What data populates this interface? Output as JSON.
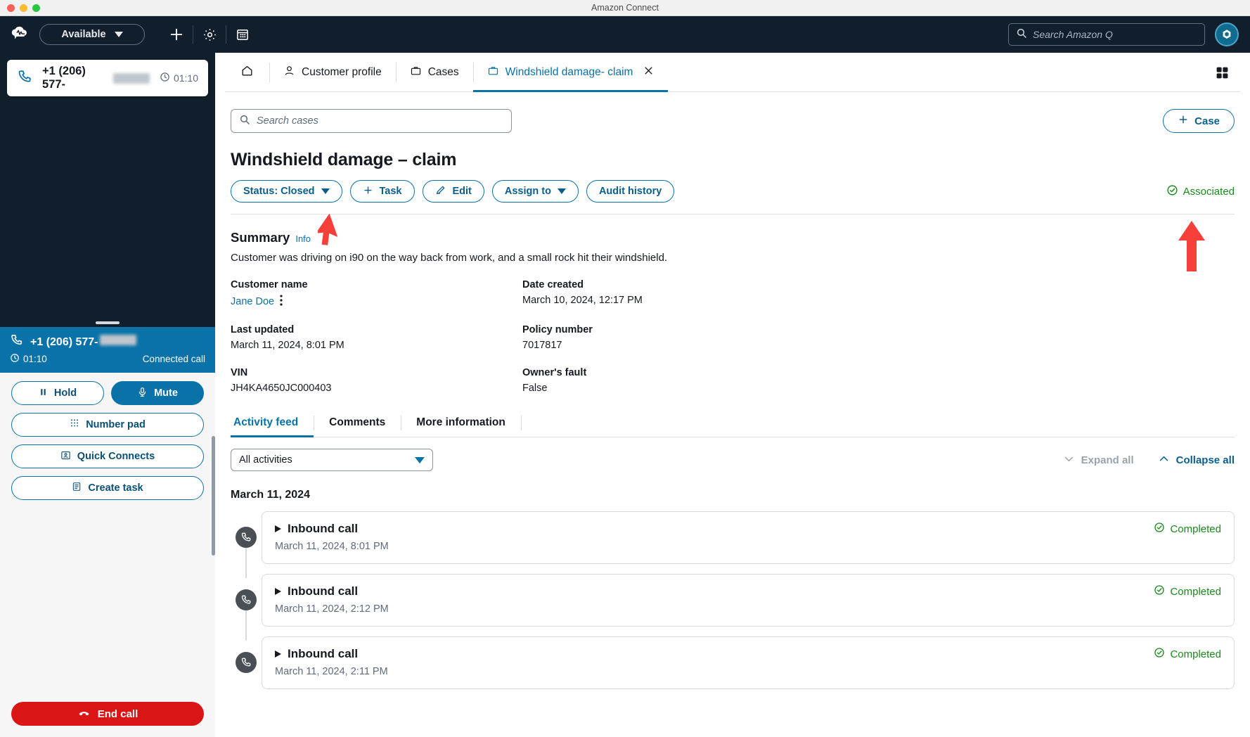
{
  "window": {
    "title": "Amazon Connect"
  },
  "topnav": {
    "logo_icon": "amazon-connect-cloud-logo",
    "status": {
      "label": "Available",
      "caret_icon": "chevron-down-icon"
    },
    "icons": [
      {
        "name": "add-icon",
        "glyph": "+"
      },
      {
        "name": "gear-icon",
        "glyph": "gear"
      },
      {
        "name": "calendar-icon",
        "glyph": "calendar"
      }
    ],
    "search": {
      "placeholder": "Search Amazon Q",
      "value": "",
      "icon": "search-icon"
    },
    "amazon_q_avatar": "amazon-q-icon"
  },
  "ccp": {
    "contact_card": {
      "phone": "+1 (206) 577-",
      "timer": "01:10",
      "phone_icon": "phone-icon",
      "clock_icon": "clock-icon"
    },
    "call_banner": {
      "phone": "+1 (206) 577-",
      "timer": "01:10",
      "state": "Connected call"
    },
    "buttons": [
      {
        "name": "hold-button",
        "label": "Hold",
        "icon": "pause-icon",
        "filled": false
      },
      {
        "name": "mute-button",
        "label": "Mute",
        "icon": "microphone-icon",
        "filled": true
      },
      {
        "name": "number-pad-button",
        "label": "Number pad",
        "icon": "dialpad-icon",
        "filled": false
      },
      {
        "name": "quick-connects-button",
        "label": "Quick Connects",
        "icon": "contact-card-icon",
        "filled": false
      },
      {
        "name": "create-task-button",
        "label": "Create task",
        "icon": "task-icon",
        "filled": false
      }
    ],
    "end_call": {
      "label": "End call",
      "icon": "end-call-icon",
      "color": "#d91515"
    }
  },
  "tabs": [
    {
      "name": "tab-home",
      "label": "",
      "icon": "home-icon",
      "active": false,
      "closable": false
    },
    {
      "name": "tab-customer-profile",
      "label": "Customer profile",
      "icon": "user-icon",
      "active": false,
      "closable": false
    },
    {
      "name": "tab-cases",
      "label": "Cases",
      "icon": "briefcase-icon",
      "active": false,
      "closable": false
    },
    {
      "name": "tab-windshield-damage-claim",
      "label": "Windshield damage- claim",
      "icon": "briefcase-icon",
      "active": true,
      "closable": true,
      "close_icon": "close-icon"
    }
  ],
  "tabbar_right": {
    "grid_icon": "apps-grid-icon"
  },
  "case_search": {
    "placeholder": "Search cases",
    "value": "",
    "icon": "search-icon"
  },
  "add_case_button": {
    "label": "Case",
    "icon": "plus-icon"
  },
  "case": {
    "title": "Windshield damage – claim",
    "actions": [
      {
        "name": "status-button",
        "label": "Status: Closed",
        "caret": true
      },
      {
        "name": "task-button",
        "label": "Task",
        "icon": "plus-icon"
      },
      {
        "name": "edit-button",
        "label": "Edit",
        "icon": "pencil-icon"
      },
      {
        "name": "assign-to-button",
        "label": "Assign to",
        "caret": true
      },
      {
        "name": "audit-history-button",
        "label": "Audit history"
      }
    ],
    "associated": {
      "label": "Associated",
      "icon": "check-circle-icon",
      "color": "#1a8a1a"
    },
    "summary": {
      "title": "Summary",
      "info_link": "Info",
      "text": "Customer was driving on i90 on the way back from work, and a small rock hit their windshield."
    },
    "fields": [
      [
        {
          "name": "customer-name",
          "label": "Customer name",
          "value": "Jane Doe",
          "is_link": true,
          "has_kebab": true
        },
        {
          "name": "date-created",
          "label": "Date created",
          "value": "March 10, 2024, 12:17 PM",
          "is_link": false,
          "has_kebab": false
        }
      ],
      [
        {
          "name": "last-updated",
          "label": "Last updated",
          "value": "March 11, 2024, 8:01 PM",
          "is_link": false,
          "has_kebab": false
        },
        {
          "name": "policy-number",
          "label": "Policy number",
          "value": "7017817",
          "is_link": false,
          "has_kebab": false
        }
      ],
      [
        {
          "name": "vin",
          "label": "VIN",
          "value": "JH4KA4650JC000403",
          "is_link": false,
          "has_kebab": false
        },
        {
          "name": "owners-fault",
          "label": "Owner's fault",
          "value": "False",
          "is_link": false,
          "has_kebab": false
        }
      ]
    ]
  },
  "feed_tabs": [
    {
      "name": "tab-activity-feed",
      "label": "Activity feed",
      "active": true
    },
    {
      "name": "tab-comments",
      "label": "Comments",
      "active": false
    },
    {
      "name": "tab-more-information",
      "label": "More information",
      "active": false
    }
  ],
  "feed_filter": {
    "value": "All activities",
    "caret_icon": "chevron-down-icon"
  },
  "expand_all": {
    "label": "Expand all",
    "icon": "chevron-down-icon",
    "enabled": false
  },
  "collapse_all": {
    "label": "Collapse all",
    "icon": "chevron-up-icon",
    "enabled": true
  },
  "activity": {
    "date_header": "March 11, 2024",
    "items": [
      {
        "title": "Inbound call",
        "timestamp": "March 11, 2024, 8:01 PM",
        "status": "Completed",
        "icon": "phone-icon",
        "status_icon": "check-circle-icon"
      },
      {
        "title": "Inbound call",
        "timestamp": "March 11, 2024, 2:12 PM",
        "status": "Completed",
        "icon": "phone-icon",
        "status_icon": "check-circle-icon"
      },
      {
        "title": "Inbound call",
        "timestamp": "March 11, 2024, 2:11 PM",
        "status": "Completed",
        "icon": "phone-icon",
        "status_icon": "check-circle-icon"
      }
    ]
  },
  "annotations": [
    {
      "name": "arrow-pointing-to-status-button",
      "color": "#f7403a"
    },
    {
      "name": "arrow-pointing-to-associated-badge",
      "color": "#f7403a"
    }
  ],
  "colors": {
    "nav_bg": "#111e2c",
    "accent": "#0972a8",
    "success": "#1a8a1a",
    "danger": "#d91515"
  }
}
